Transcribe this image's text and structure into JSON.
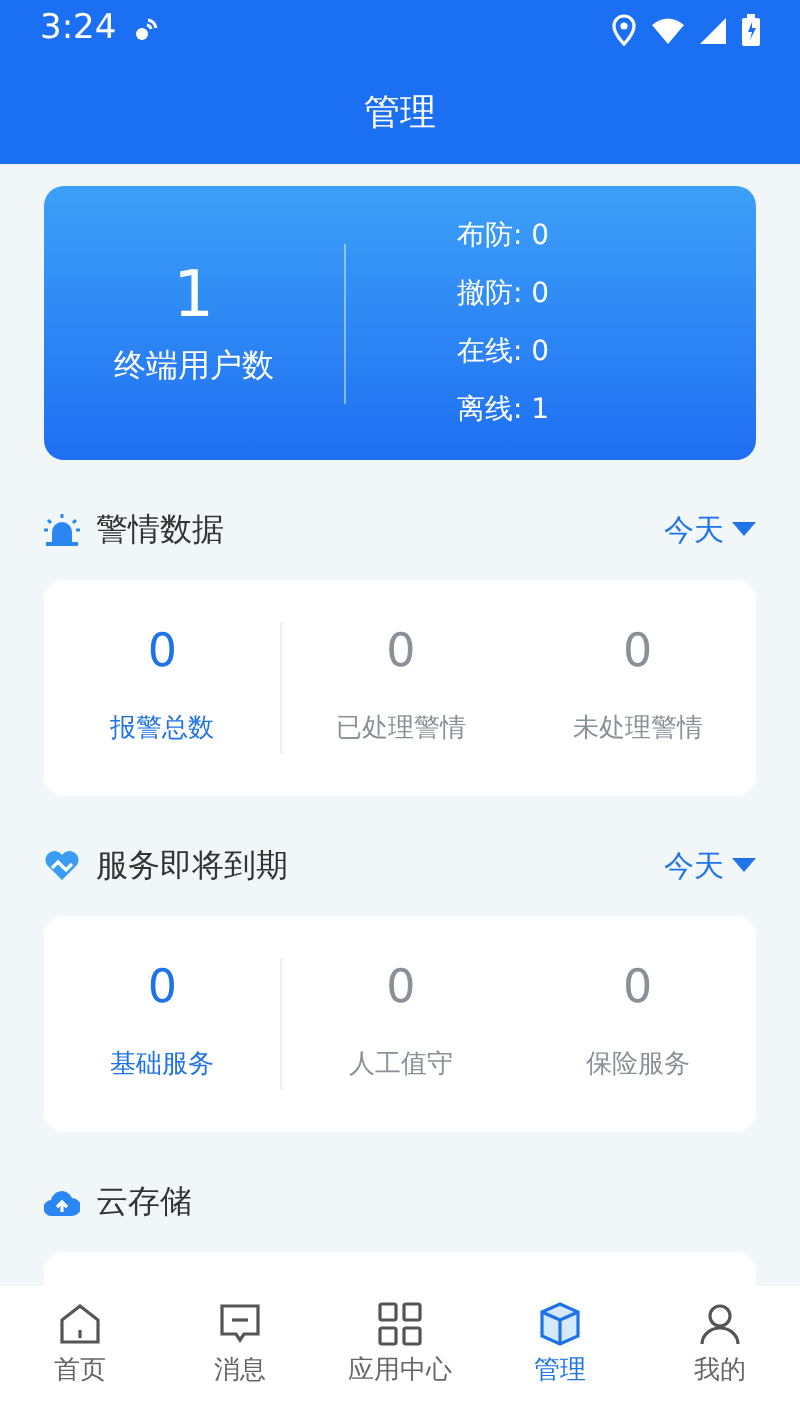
{
  "status_bar": {
    "time": "3:24"
  },
  "header": {
    "title": "管理"
  },
  "summary": {
    "value": "1",
    "label": "终端用户数",
    "stats": [
      {
        "label": "布防:",
        "value": "0"
      },
      {
        "label": "撤防:",
        "value": "0"
      },
      {
        "label": "在线:",
        "value": "0"
      },
      {
        "label": "离线:",
        "value": "1"
      }
    ]
  },
  "sections": [
    {
      "kind": "alarm",
      "title": "警情数据",
      "filter": "今天",
      "metrics": [
        {
          "value": "0",
          "label": "报警总数",
          "selected": true
        },
        {
          "value": "0",
          "label": "已处理警情",
          "selected": false
        },
        {
          "value": "0",
          "label": "未处理警情",
          "selected": false
        }
      ]
    },
    {
      "kind": "service",
      "title": "服务即将到期",
      "filter": "今天",
      "metrics": [
        {
          "value": "0",
          "label": "基础服务",
          "selected": true
        },
        {
          "value": "0",
          "label": "人工值守",
          "selected": false
        },
        {
          "value": "0",
          "label": "保险服务",
          "selected": false
        }
      ]
    },
    {
      "kind": "cloud",
      "title": "云存储"
    }
  ],
  "tab_bar": [
    {
      "kind": "home",
      "label": "首页",
      "selected": false
    },
    {
      "kind": "message",
      "label": "消息",
      "selected": false
    },
    {
      "kind": "apps",
      "label": "应用中心",
      "selected": false
    },
    {
      "kind": "manage",
      "label": "管理",
      "selected": true
    },
    {
      "kind": "profile",
      "label": "我的",
      "selected": false
    }
  ]
}
